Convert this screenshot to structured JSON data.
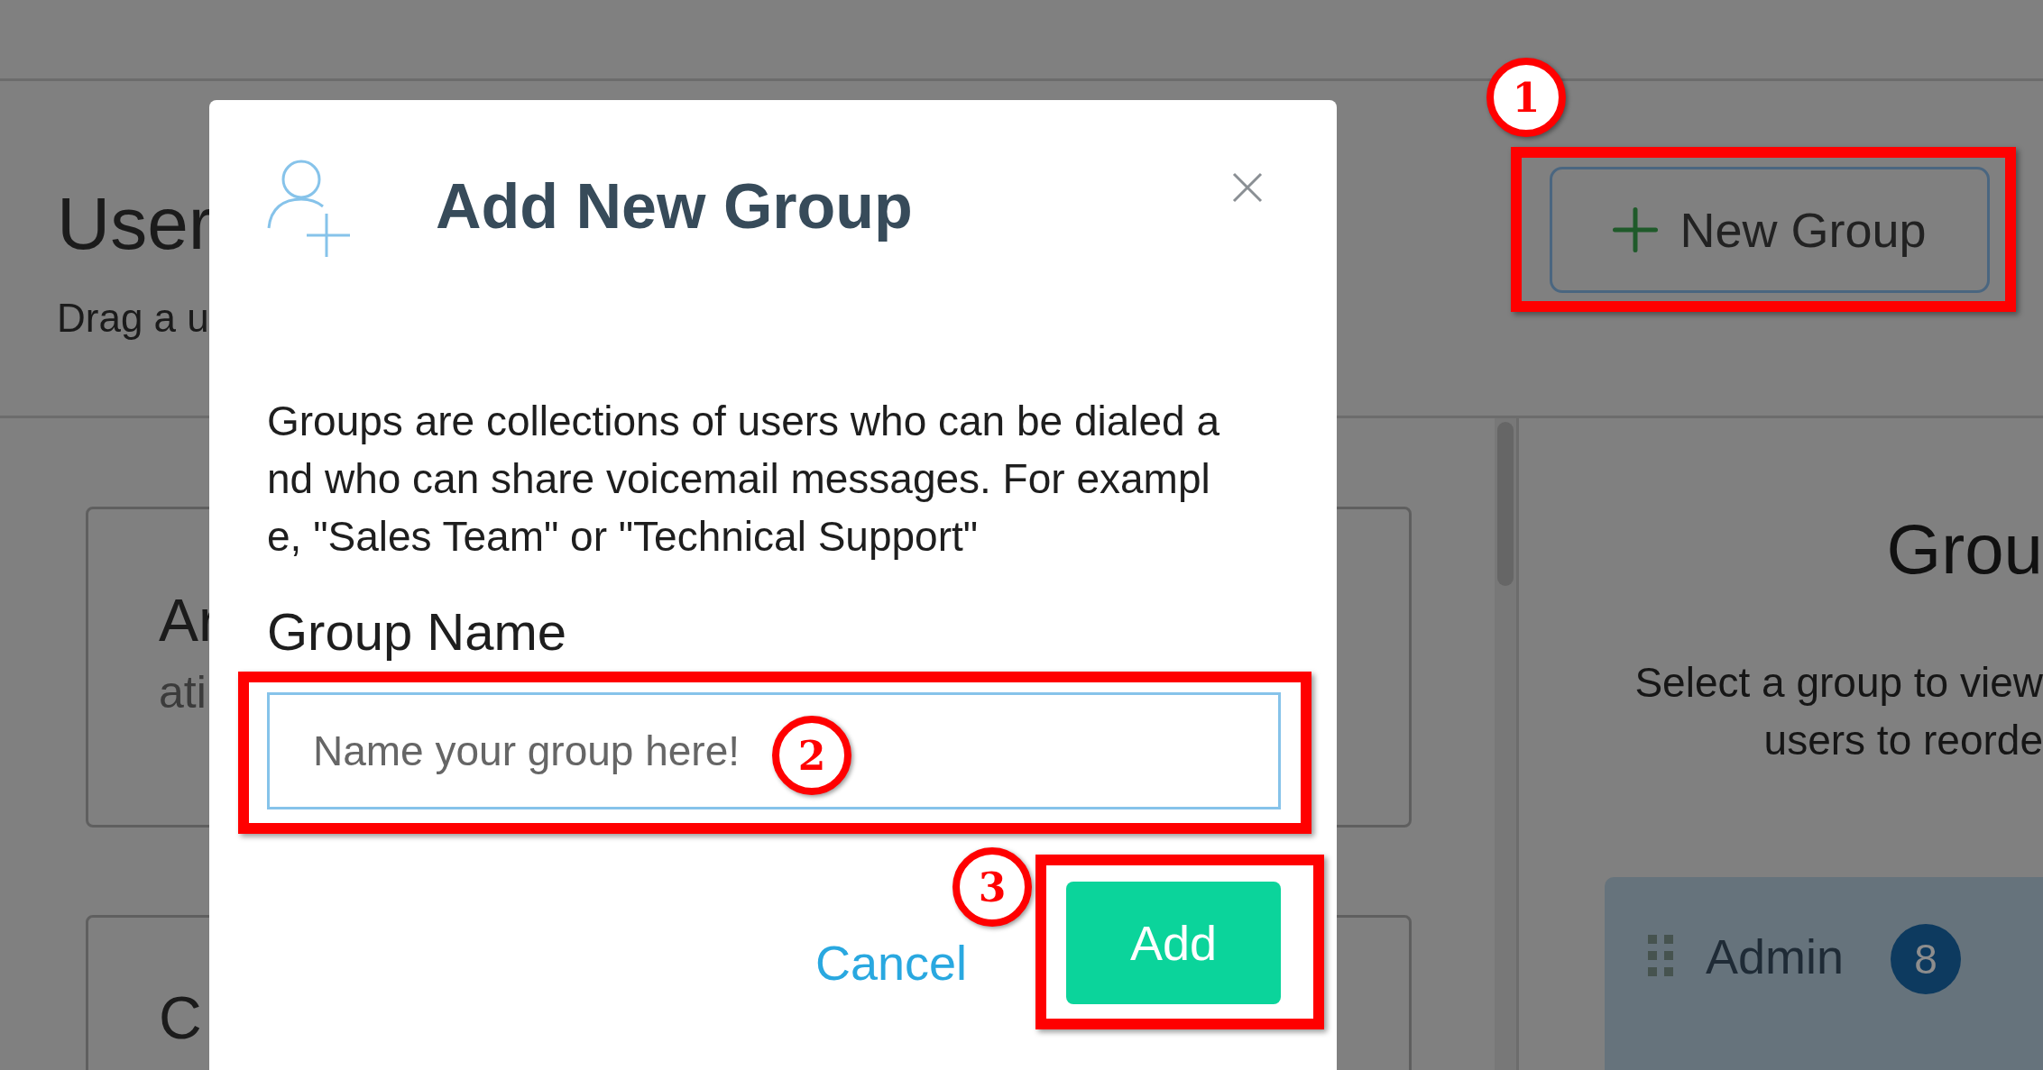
{
  "page": {
    "title": "User",
    "subtitle": "Drag a u"
  },
  "new_group_button": {
    "label": "New Group"
  },
  "user_cards": [
    {
      "name": "Ar",
      "detail": "ati"
    },
    {
      "name": "C"
    }
  ],
  "groups_panel": {
    "title": "Grou",
    "hint_lines": [
      "Select a group to view",
      "users to reorde"
    ],
    "groups": [
      {
        "name": "Admin",
        "count": "8"
      }
    ]
  },
  "dialog": {
    "title": "Add New Group",
    "description": "Groups are collections of users who can be dialed and who can share voicemail messages. For example, \"Sales Team\" or \"Technical Support\"",
    "field_label": "Group Name",
    "field": {
      "placeholder": "Name your group here!"
    },
    "buttons": [
      {
        "kind": "secondary",
        "label": "Cancel"
      },
      {
        "kind": "primary",
        "label": "Add"
      }
    ]
  },
  "annotations": [
    {
      "number": "1"
    },
    {
      "number": "2"
    },
    {
      "number": "3"
    }
  ]
}
